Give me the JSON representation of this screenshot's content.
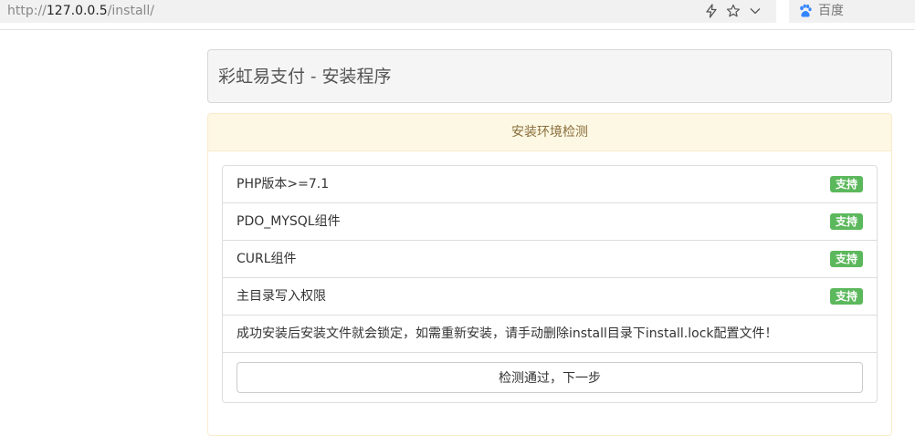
{
  "browser": {
    "url_scheme": "http://",
    "url_host": "127.0.0.5",
    "url_path": "/install/",
    "search_engine": "百度"
  },
  "page": {
    "title": "彩虹易支付 - 安装程序"
  },
  "check": {
    "heading": "安装环境检测",
    "items": [
      {
        "label": "PHP版本>=7.1",
        "status": "支持"
      },
      {
        "label": "PDO_MYSQL组件",
        "status": "支持"
      },
      {
        "label": "CURL组件",
        "status": "支持"
      },
      {
        "label": "主目录写入权限",
        "status": "支持"
      }
    ],
    "notice": "成功安装后安装文件就会锁定，如需重新安装，请手动删除install目录下install.lock配置文件！",
    "next_button": "检测通过，下一步"
  },
  "colors": {
    "success": "#5cb85c",
    "warning_bg": "#fcf8e3",
    "warning_border": "#faebcc",
    "warning_text": "#8a6d3b"
  }
}
